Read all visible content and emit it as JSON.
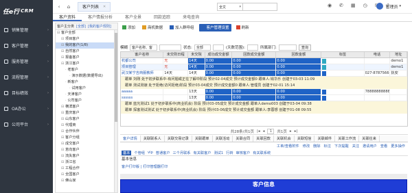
{
  "app": {
    "logo_text": "任e行",
    "logo_sub": "CRM"
  },
  "sidebar": {
    "items": [
      {
        "label": "销售管理",
        "icon": "chart-icon"
      },
      {
        "label": "客户管理",
        "icon": "user-icon"
      },
      {
        "label": "服务管理",
        "icon": "service-icon"
      },
      {
        "label": "流程管理",
        "icon": "flow-icon"
      },
      {
        "label": "目标绩效",
        "icon": "target-icon"
      },
      {
        "label": "OA办公",
        "icon": "office-icon"
      },
      {
        "label": "公司平台",
        "icon": "company-icon"
      }
    ]
  },
  "topbar": {
    "tab_label": "客户列表",
    "search_scope": "全文",
    "user_name": "管理员"
  },
  "subtabs": [
    "客户资料",
    "客户情报分析",
    "客户全景",
    "回款追踪",
    "来电查询"
  ],
  "tree": {
    "head": [
      "客户主分类",
      "[全部]",
      "[我的客户规则]"
    ],
    "rows": [
      {
        "text": "客户全部",
        "indent": 0
      },
      {
        "text": "项目客户",
        "indent": 1
      },
      {
        "text": "我的客户(1/8)",
        "indent": 1
      },
      {
        "text": "自然客户",
        "indent": 1
      },
      {
        "text": "报备客户",
        "indent": 1
      },
      {
        "text": "浙江客户",
        "indent": 1
      },
      {
        "text": "老客户",
        "indent": 2
      },
      {
        "text": "演示数据(数据导出)",
        "indent": 3
      },
      {
        "text": "新客户",
        "indent": 2
      },
      {
        "text": "试用客户",
        "indent": 3
      },
      {
        "text": "天津客户",
        "indent": 2
      },
      {
        "text": "公司客户",
        "indent": 2
      },
      {
        "text": "横滨客户",
        "indent": 1
      },
      {
        "text": "重庆客户",
        "indent": 1
      },
      {
        "text": "山东客户",
        "indent": 1
      },
      {
        "text": "代理商",
        "indent": 1
      },
      {
        "text": "合作伙伴",
        "indent": 1
      },
      {
        "text": "客户分组",
        "indent": 1
      },
      {
        "text": "成交客户",
        "indent": 1
      },
      {
        "text": "意向客户",
        "indent": 1
      },
      {
        "text": "流失客户",
        "indent": 1
      },
      {
        "text": "浙江省",
        "indent": 1
      },
      {
        "text": "工程合作",
        "indent": 1
      },
      {
        "text": "全国客户",
        "indent": 1
      },
      {
        "text": "佛山家",
        "indent": 1
      }
    ]
  },
  "toolbar": {
    "buttons": [
      "添加",
      "商机数据",
      "加入群呼组",
      "客户管理设置",
      "刷新"
    ]
  },
  "filter": {
    "field_label": "模糊",
    "field_value": "客户名称、客户名",
    "status_label": "状态:",
    "status_value": "全部",
    "days_label": "(天数范围):",
    "dept_label": "所属部门:",
    "query": "查询"
  },
  "grid": {
    "columns": [
      "客户名称",
      "未交则日程",
      "未交院",
      "成功成交金额",
      "回款成交金额",
      "回款金额",
      "标签",
      "电话",
      "地址"
    ],
    "rows": [
      {
        "name": "杭都公司",
        "c2": "无",
        "c3": "14天",
        "c4": "0.00",
        "c5": "0.00",
        "c6": "0.00",
        "tag": "",
        "phone": "",
        "addr": "demo1"
      },
      {
        "name": "项目管理",
        "c2": "无",
        "c3": "14天",
        "c4": "0.00",
        "c5": "0.00",
        "c6": "0.00",
        "tag": "",
        "phone": "",
        "addr": "demo1"
      },
      {
        "name": "武汉某宁吉商服教师",
        "c2": "14天",
        "c3": "14天",
        "c4": "0.00",
        "c5": "0.00",
        "c6": "0.00",
        "tag": "",
        "phone": "027-87875666,131",
        "addr": "执安"
      },
      {
        "name": "aaaaa",
        "c2": "",
        "c3": "13天",
        "c4": "0.00",
        "c5": "0.00",
        "c6": "0.00",
        "tag": "",
        "phone": "78888888888",
        "addr": ""
      },
      {
        "name": "ssssss",
        "c2": "",
        "c3": "13天",
        "c4": "0.00",
        "c5": "0.00",
        "c6": "0.00",
        "tag": "",
        "phone": "",
        "addr": ""
      }
    ],
    "notes": [
      "跟单 刘刚  处于初步联系中-有问题或正在了解中阶段  预计02-04成交  预计成交金额0  跟单人:钱华乐  创建于03-03 11:09",
      "跟单 测试测速  处于拒绝(访问拒绝)阶段  预计03-04成交  预计成交金额0  跟单人:管理员  创建于02-01 15:14",
      "跟单 蓝光测试1  处于初步联系中(商业机会) 阶段  预计03-05成交  预计成交金额  跟单人demo003  创建于03-04 09:38",
      "跟单 探客测试测试  处于初步联系中(商业机会) 阶段  预计03-06成交  预计成交金额  跟单人:李蓉想  创建于01-08 09:55"
    ]
  },
  "pager": {
    "text": "共28条/共1页",
    "page": "1",
    "total": "共1页"
  },
  "detail_tabs": [
    "客户详情",
    "关联联系人",
    "关联交易记录",
    "关联跟单",
    "关联活动",
    "关联合同",
    "关联回款",
    "关联机会",
    "关联短信",
    "关联邮件",
    "关联工作流",
    "关联往来"
  ],
  "actions": [
    "工单/查看附件",
    "修改",
    "删除",
    "标注",
    "下次提醒",
    "关注",
    "邀请用户",
    "查看",
    "更多操作"
  ],
  "subnav": [
    "基本",
    "个管组",
    "vip",
    "普通客户",
    "三个月联系",
    "有关联客户",
    "测试1",
    "行转",
    "审核客户",
    "有关联系统"
  ],
  "basic_label": "基本信息",
  "links": "客户打印版  |  打印管理器打印",
  "card_title": "客户信息"
}
